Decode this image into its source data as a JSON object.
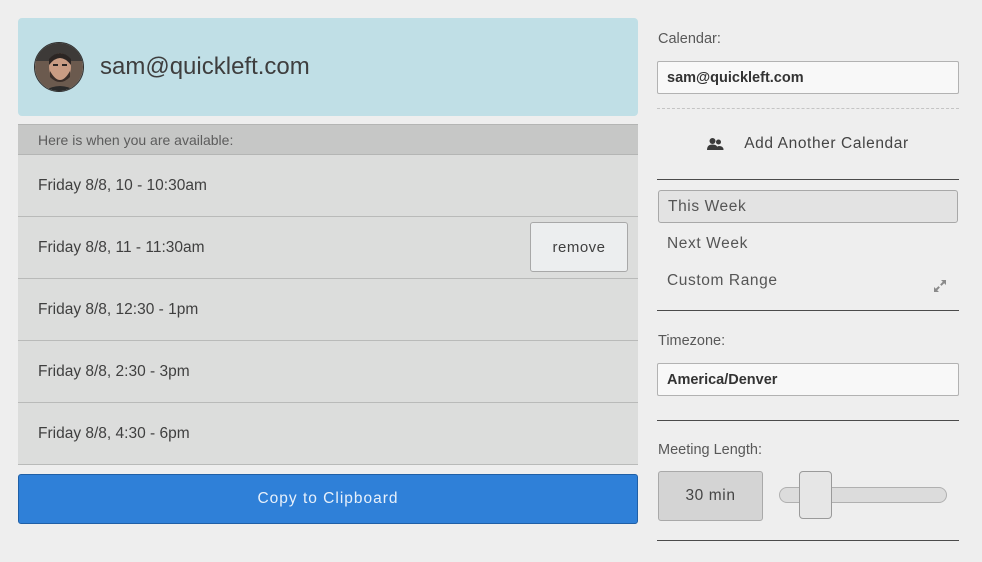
{
  "user": {
    "email": "sam@quickleft.com"
  },
  "availability": {
    "caption": "Here is when you are available:",
    "slots": [
      "Friday 8/8, 10 - 10:30am",
      "Friday 8/8, 11 - 11:30am",
      "Friday 8/8, 12:30 - 1pm",
      "Friday 8/8, 2:30 - 3pm",
      "Friday 8/8, 4:30 - 6pm"
    ],
    "remove_label": "remove"
  },
  "copy_button": {
    "label": "Copy to Clipboard"
  },
  "calendar": {
    "label": "Calendar:",
    "value": "sam@quickleft.com",
    "add_label": "Add Another Calendar"
  },
  "ranges": {
    "this_week": "This Week",
    "next_week": "Next Week",
    "custom_range": "Custom Range",
    "selected": "This Week"
  },
  "timezone": {
    "label": "Timezone:",
    "value": "America/Denver"
  },
  "meeting": {
    "label": "Meeting Length:",
    "value": "30 min"
  },
  "colors": {
    "header_bg": "#c0dfe6",
    "primary_button": "#2f80d8",
    "page_bg": "#eeeeee"
  },
  "icons": {
    "avatar": "user-photo",
    "add_calendar": "users-icon",
    "custom_range": "expand-icon"
  }
}
